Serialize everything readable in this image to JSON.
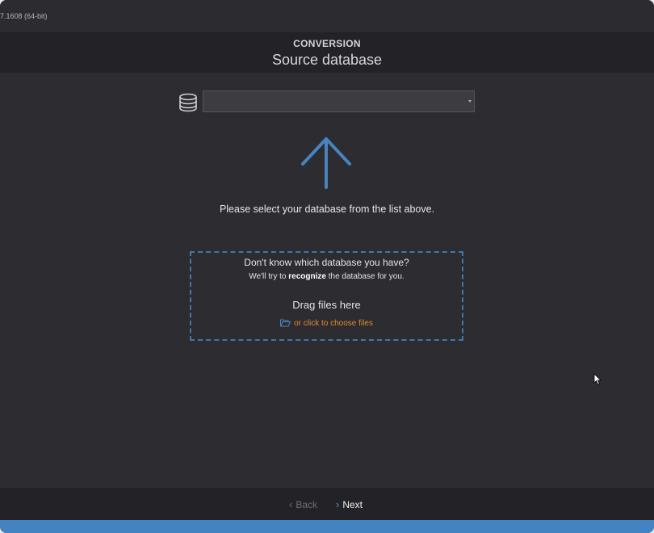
{
  "window": {
    "version_text": "7.1608 (64-bit)"
  },
  "header": {
    "step": "CONVERSION",
    "title": "Source database"
  },
  "database_select": {
    "icon": "database-icon",
    "value": "",
    "caret_icon": "caret-down-icon"
  },
  "main": {
    "arrow_icon": "arrow-up-icon",
    "hint": "Please select your database from the list above."
  },
  "dropzone": {
    "question": "Don't know which database you have?",
    "sub_before": "We'll try to ",
    "sub_bold": "recognize",
    "sub_after": " the database for you.",
    "drag_text": "Drag files here",
    "choose_text": "or click to choose files",
    "folder_icon": "folder-open-icon",
    "border_color": "#3f77ad"
  },
  "footer": {
    "back_label": "Back",
    "next_label": "Next"
  },
  "colors": {
    "accent": "#4483c2",
    "link": "#e0892d",
    "background": "#2d2c31",
    "header_bg": "#232226"
  }
}
